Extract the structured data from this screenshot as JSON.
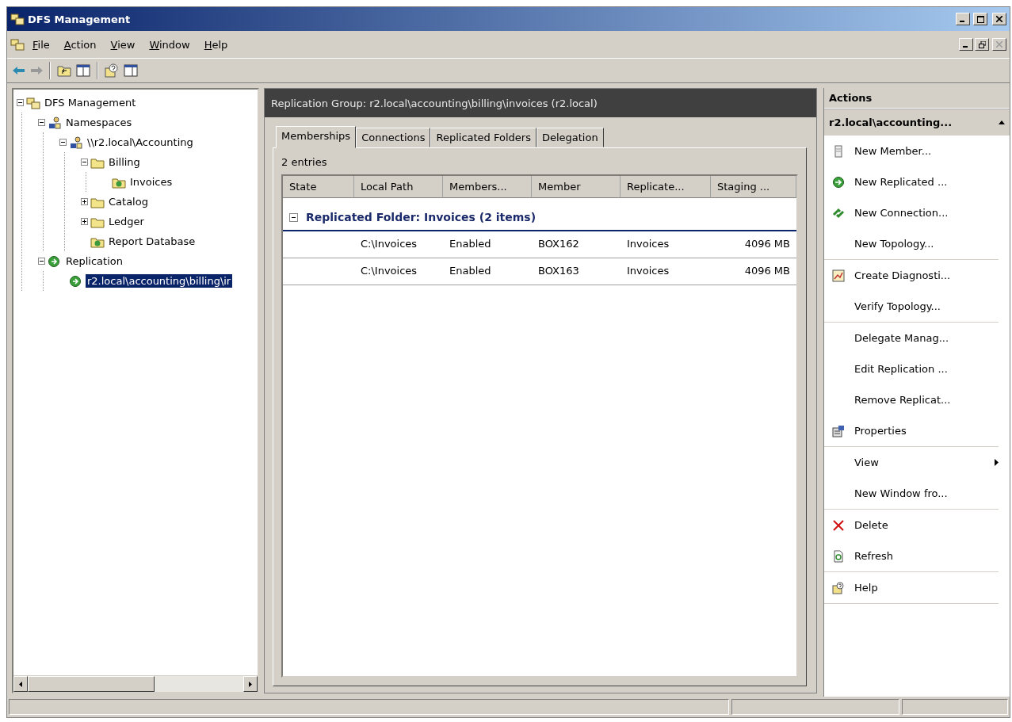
{
  "window": {
    "title": "DFS Management"
  },
  "menu": [
    "File",
    "Action",
    "View",
    "Window",
    "Help"
  ],
  "tree": [
    {
      "label": "DFS Management",
      "kind": "root",
      "expanded": true,
      "selected": false,
      "children": [
        {
          "label": "Namespaces",
          "kind": "namespaces",
          "expanded": true,
          "selected": false,
          "children": [
            {
              "label": "\\\\r2.local\\Accounting",
              "kind": "namespace",
              "expanded": true,
              "selected": false,
              "children": [
                {
                  "label": "Billing",
                  "kind": "folder",
                  "expanded": true,
                  "selected": false,
                  "children": [
                    {
                      "label": "Invoices",
                      "kind": "target",
                      "selected": false
                    }
                  ]
                },
                {
                  "label": "Catalog",
                  "kind": "folder",
                  "expanded": false,
                  "selected": false
                },
                {
                  "label": "Ledger",
                  "kind": "folder",
                  "expanded": false,
                  "selected": false
                },
                {
                  "label": "Report Database",
                  "kind": "target",
                  "selected": false
                }
              ]
            }
          ]
        },
        {
          "label": "Replication",
          "kind": "replication",
          "expanded": true,
          "selected": false,
          "children": [
            {
              "label": "r2.local\\accounting\\billing\\ir",
              "kind": "group",
              "selected": true
            }
          ]
        }
      ]
    }
  ],
  "content": {
    "title": "Replication Group: r2.local\\accounting\\billing\\invoices (r2.local)",
    "tabs": [
      {
        "label": "Memberships",
        "selected": true
      },
      {
        "label": "Connections",
        "selected": false
      },
      {
        "label": "Replicated Folders",
        "selected": false
      },
      {
        "label": "Delegation",
        "selected": false
      }
    ],
    "entries": "2 entries",
    "table": {
      "columns": [
        "State",
        "Local Path",
        "Members...",
        "Member",
        "Replicate...",
        "Staging ..."
      ],
      "group": {
        "label": "Replicated Folder: Invoices (2 items)",
        "expanded": true
      },
      "rows": [
        [
          "",
          "C:\\Invoices",
          "Enabled",
          "BOX162",
          "Invoices",
          "4096 MB"
        ],
        [
          "",
          "C:\\Invoices",
          "Enabled",
          "BOX163",
          "Invoices",
          "4096 MB"
        ]
      ]
    }
  },
  "actions": {
    "title": "Actions",
    "section": "r2.local\\accounting...",
    "groups": [
      [
        {
          "label": "New Member...",
          "kind": "member"
        },
        {
          "label": "New Replicated ...",
          "kind": "replicated"
        },
        {
          "label": "New Connection...",
          "kind": "connection"
        },
        {
          "label": "New Topology...",
          "kind": "plain"
        }
      ],
      [
        {
          "label": "Create Diagnosti...",
          "kind": "diagnostic"
        },
        {
          "label": "Verify Topology...",
          "kind": "plain"
        }
      ],
      [
        {
          "label": "Delegate Manag...",
          "kind": "plain"
        },
        {
          "label": "Edit Replication ...",
          "kind": "plain"
        },
        {
          "label": "Remove Replicat...",
          "kind": "plain"
        },
        {
          "label": "Properties",
          "kind": "properties"
        }
      ],
      [
        {
          "label": "View",
          "kind": "submenu"
        },
        {
          "label": "New Window fro...",
          "kind": "plain"
        }
      ],
      [
        {
          "label": "Delete",
          "kind": "delete"
        },
        {
          "label": "Refresh",
          "kind": "refresh"
        }
      ],
      [
        {
          "label": "Help",
          "kind": "help"
        }
      ]
    ]
  }
}
